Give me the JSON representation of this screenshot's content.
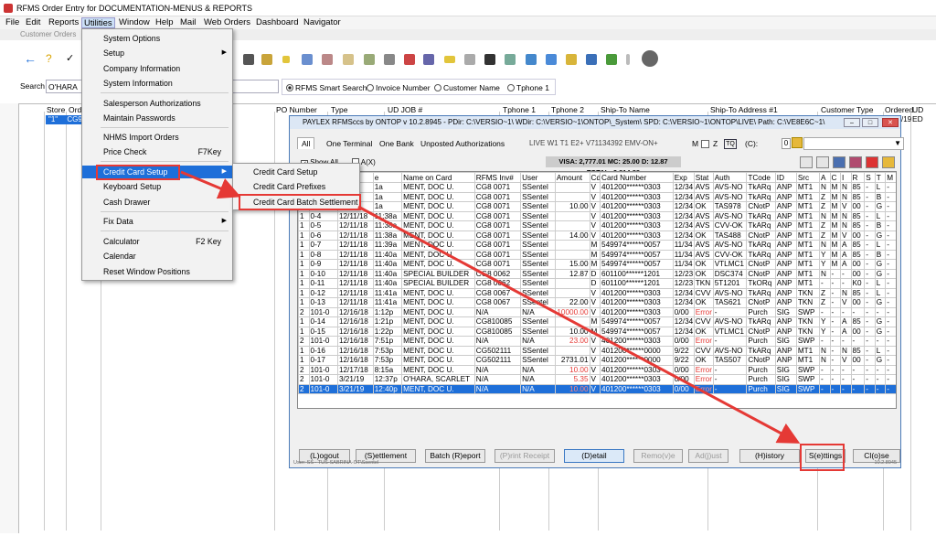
{
  "window": {
    "title": "RFMS Order Entry for DOCUMENTATION-MENUS & REPORTS"
  },
  "menubar": [
    "File",
    "Edit",
    "Reports",
    "Utilities",
    "Window",
    "Help",
    "Mail",
    "Web Orders",
    "Dashboard",
    "Navigator"
  ],
  "subwindow_title": "Customer Orders",
  "search": {
    "label": "Search",
    "value": "O'HARA",
    "options": [
      "RFMS Smart Search",
      "Invoice Number",
      "Customer Name",
      "Tphone 1"
    ]
  },
  "list_headers": [
    "Store",
    "Order",
    "PO Number",
    "Type",
    "UD JOB #",
    "Tphone 1",
    "Tphone 2",
    "Ship-To Name",
    "Ship-To Address #1",
    "Customer Type",
    "Ordered",
    "UD ED"
  ],
  "selected_row": {
    "store": "\"1\"",
    "order": "CG9",
    "ordered": "/19"
  },
  "utilities_menu": [
    {
      "label": "System Options"
    },
    {
      "label": "Setup",
      "arrow": true
    },
    {
      "label": "Company Information"
    },
    {
      "label": "System Information"
    },
    {
      "label": "Salesperson Authorizations"
    },
    {
      "label": "Maintain Passwords"
    },
    {
      "label": "NHMS Import Orders"
    },
    {
      "label": "Price Check",
      "shortcut": "F7Key"
    },
    {
      "label": "Credit Card Setup",
      "arrow": true
    },
    {
      "label": "Keyboard Setup"
    },
    {
      "label": "Cash Drawer"
    },
    {
      "label": "Fix Data",
      "arrow": true
    },
    {
      "label": "Calculator",
      "shortcut": "F2 Key"
    },
    {
      "label": "Calendar"
    },
    {
      "label": "Reset Window Positions"
    }
  ],
  "submenu": [
    "Credit Card Setup",
    "Credit Card Prefixes",
    "Credit Card Batch Settlement"
  ],
  "dialog": {
    "title": "PAYLEX RFMSccs by ONTOP  v 10.2.8945  - PDir: C:\\VERSIO~1\\  WDir: C:\\VERSIO~1\\ONTOP\\_System\\  SPD: C:\\VERSIO~1\\ONTOP\\LIVE\\  Path: C:\\VE8E6C~1\\",
    "tabs": [
      "All",
      "One Terminal",
      "One Bank",
      "Unposted Authorizations"
    ],
    "status": "LIVE  W1  T1  E2+  V71134392  EMV-ON+",
    "m_label": "M",
    "z_label": "Z",
    "tq": "TQ",
    "c_label": "(C):",
    "c_value": "0",
    "show_all": "Show All",
    "a_x": "A(X)",
    "totals": "VISA: 2,777.01   MC: 25.00   D: 12.87   TOTAL: 2,814.88",
    "columns": [
      "",
      "",
      "",
      "e",
      "Name on Card",
      "RFMS Inv#",
      "User",
      "Amount",
      "Cd",
      "Card Number",
      "Exp",
      "Stat",
      "Auth",
      "TCode",
      "ID",
      "Src",
      "A",
      "C",
      "I",
      "R",
      "S",
      "T",
      "M"
    ],
    "rows": [
      [
        "1",
        "",
        "",
        "1a",
        "MENT, DOC U.",
        "CG8 0071",
        "SSentel",
        "",
        "V",
        "401200******0303",
        "12/34",
        "AVS",
        "AVS-NO",
        "TkARq",
        "ANP",
        "MT1",
        "N",
        "M",
        "N",
        "85",
        "-",
        "L",
        "-"
      ],
      [
        "1",
        "",
        "",
        "1a",
        "MENT, DOC U.",
        "CG8 0071",
        "SSentel",
        "",
        "V",
        "401200******0303",
        "12/34",
        "AVS",
        "AVS-NO",
        "TkARq",
        "ANP",
        "MT1",
        "Z",
        "M",
        "N",
        "85",
        "-",
        "B",
        "-"
      ],
      [
        "1",
        "",
        "",
        "1a",
        "MENT, DOC U.",
        "CG8 0071",
        "SSentel",
        "10.00",
        "V",
        "401200******0303",
        "12/34",
        "OK",
        "TAS978",
        "CNotP",
        "ANP",
        "MT1",
        "Z",
        "M",
        "V",
        "00",
        "-",
        "G",
        "-"
      ],
      [
        "1",
        "0-4",
        "12/11/18",
        "11:38a",
        "MENT, DOC U.",
        "CG8 0071",
        "SSentel",
        "",
        "V",
        "401200******0303",
        "12/34",
        "AVS",
        "AVS-NO",
        "TkARq",
        "ANP",
        "MT1",
        "N",
        "M",
        "N",
        "85",
        "-",
        "L",
        "-"
      ],
      [
        "1",
        "0-5",
        "12/11/18",
        "11:38a",
        "MENT, DOC U.",
        "CG8 0071",
        "SSentel",
        "",
        "V",
        "401200******0303",
        "12/34",
        "AVS",
        "CVV-OK",
        "TkARq",
        "ANP",
        "MT1",
        "Z",
        "M",
        "N",
        "85",
        "-",
        "B",
        "-"
      ],
      [
        "1",
        "0-6",
        "12/11/18",
        "11:38a",
        "MENT, DOC U.",
        "CG8 0071",
        "SSentel",
        "14.00",
        "V",
        "401200******0303",
        "12/34",
        "OK",
        "TAS488",
        "CNotP",
        "ANP",
        "MT1",
        "Z",
        "M",
        "V",
        "00",
        "-",
        "G",
        "-"
      ],
      [
        "1",
        "0-7",
        "12/11/18",
        "11:39a",
        "MENT, DOC U.",
        "CG8 0071",
        "SSentel",
        "",
        "M",
        "549974******0057",
        "11/34",
        "AVS",
        "AVS-NO",
        "TkARq",
        "ANP",
        "MT1",
        "N",
        "M",
        "A",
        "85",
        "-",
        "L",
        "-"
      ],
      [
        "1",
        "0-8",
        "12/11/18",
        "11:40a",
        "MENT, DOC U.",
        "CG8 0071",
        "SSentel",
        "",
        "M",
        "549974******0057",
        "11/34",
        "AVS",
        "CVV-OK",
        "TkARq",
        "ANP",
        "MT1",
        "Y",
        "M",
        "A",
        "85",
        "-",
        "B",
        "-"
      ],
      [
        "1",
        "0-9",
        "12/11/18",
        "11:40a",
        "MENT, DOC U.",
        "CG8 0071",
        "SSentel",
        "15.00",
        "M",
        "549974******0057",
        "11/34",
        "OK",
        "VTLMC1",
        "CNotP",
        "ANP",
        "MT1",
        "Y",
        "M",
        "A",
        "00",
        "-",
        "G",
        "-"
      ],
      [
        "1",
        "0-10",
        "12/11/18",
        "11:40a",
        "SPECIAL BUILDER",
        "CG8 0062",
        "SSentel",
        "12.87",
        "D",
        "601100******1201",
        "12/23",
        "OK",
        "DSC374",
        "CNotP",
        "ANP",
        "MT1",
        "N",
        "-",
        "-",
        "00",
        "-",
        "G",
        "-"
      ],
      [
        "1",
        "0-11",
        "12/11/18",
        "11:40a",
        "SPECIAL BUILDER",
        "CG8 0062",
        "SSentel",
        "",
        "D",
        "601100******1201",
        "12/23",
        "TKN",
        "5T1201",
        "TkORq",
        "ANP",
        "MT1",
        "-",
        "-",
        "-",
        "K0",
        "-",
        "L",
        "-"
      ],
      [
        "1",
        "0-12",
        "12/11/18",
        "11:41a",
        "MENT, DOC U.",
        "CG8 0067",
        "SSentel",
        "",
        "V",
        "401200******0303",
        "12/34",
        "CVV",
        "AVS-NO",
        "TkARq",
        "ANP",
        "TKN",
        "Z",
        "-",
        "N",
        "85",
        "-",
        "L",
        "-"
      ],
      [
        "1",
        "0-13",
        "12/11/18",
        "11:41a",
        "MENT, DOC U.",
        "CG8 0067",
        "SSentel",
        "22.00",
        "V",
        "401200******0303",
        "12/34",
        "OK",
        "TAS621",
        "CNotP",
        "ANP",
        "TKN",
        "Z",
        "-",
        "V",
        "00",
        "-",
        "G",
        "-"
      ],
      [
        "2",
        "101-0",
        "12/16/18",
        "1:12p",
        "MENT, DOC U.",
        "N/A",
        "N/A",
        "10000.00",
        "V",
        "401200******0303",
        "0/00",
        "Error",
        "-",
        "Purch",
        "SIG",
        "SWP",
        "-",
        "-",
        "-",
        "-",
        "-",
        "-",
        "-"
      ],
      [
        "1",
        "0-14",
        "12/16/18",
        "1:21p",
        "MENT, DOC U.",
        "CG810085",
        "SSentel",
        "",
        "M",
        "549974******0057",
        "12/34",
        "CVV",
        "AVS-NO",
        "TkARq",
        "ANP",
        "TKN",
        "Y",
        "-",
        "A",
        "85",
        "-",
        "G",
        "-"
      ],
      [
        "1",
        "0-15",
        "12/16/18",
        "1:22p",
        "MENT, DOC U.",
        "CG810085",
        "SSentel",
        "10.00",
        "M",
        "549974******0057",
        "12/34",
        "OK",
        "VTLMC1",
        "CNotP",
        "ANP",
        "TKN",
        "Y",
        "-",
        "A",
        "00",
        "-",
        "G",
        "-"
      ],
      [
        "2",
        "101-0",
        "12/16/18",
        "7:51p",
        "MENT, DOC U.",
        "N/A",
        "N/A",
        "23.00",
        "V",
        "401200******0303",
        "0/00",
        "Error",
        "-",
        "Purch",
        "SIG",
        "SWP",
        "-",
        "-",
        "-",
        "-",
        "-",
        "-",
        "-"
      ],
      [
        "1",
        "0-16",
        "12/16/18",
        "7:53p",
        "MENT, DOC U.",
        "CG502111",
        "SSentel",
        "",
        "V",
        "401200******0000",
        "9/22",
        "CVV",
        "AVS-NO",
        "TkARq",
        "ANP",
        "MT1",
        "N",
        "-",
        "N",
        "85",
        "-",
        "L",
        "-"
      ],
      [
        "1",
        "0-17",
        "12/16/18",
        "7:53p",
        "MENT, DOC U.",
        "CG502111",
        "SSentel",
        "2731.01",
        "V",
        "401200******0000",
        "9/22",
        "OK",
        "TAS507",
        "CNotP",
        "ANP",
        "MT1",
        "N",
        "-",
        "V",
        "00",
        "-",
        "G",
        "-"
      ],
      [
        "2",
        "101-0",
        "12/17/18",
        "8:15a",
        "MENT, DOC U.",
        "N/A",
        "N/A",
        "10.00",
        "V",
        "401200******0303",
        "0/00",
        "Error",
        "-",
        "Purch",
        "SIG",
        "SWP",
        "-",
        "-",
        "-",
        "-",
        "-",
        "-",
        "-"
      ],
      [
        "2",
        "101-0",
        "3/21/19",
        "12:37p",
        "O'HARA, SCARLET",
        "N/A",
        "N/A",
        "5.35",
        "V",
        "401200******0303",
        "0/00",
        "Error",
        "-",
        "Purch",
        "SIG",
        "SWP",
        "-",
        "-",
        "-",
        "-",
        "-",
        "-",
        "-"
      ],
      [
        "2",
        "101-0",
        "3/21/19",
        "12:40p",
        "MENT, DOC U.",
        "N/A",
        "N/A",
        "10.00",
        "V",
        "401200******0303",
        "0/00",
        "Error",
        "-",
        "Purch",
        "SIG",
        "SWP",
        "-",
        "-",
        "-",
        "-",
        "-",
        "-",
        "-"
      ]
    ],
    "buttons": [
      "(L)ogout",
      "(S)ettlement",
      "Batch (R)eport",
      "(P)rint Receipt",
      "(D)etail",
      "Remo(v)e",
      "Ad(j)ust",
      "(H)istory",
      "S(e)ttings",
      "Cl(o)se"
    ],
    "footer": "User: SS - TUS-SABRINA-OT\\Ssentel",
    "version": "10.2.8945"
  },
  "colors": {
    "accent": "#1e6fd9",
    "highlight_box": "#e53935"
  }
}
